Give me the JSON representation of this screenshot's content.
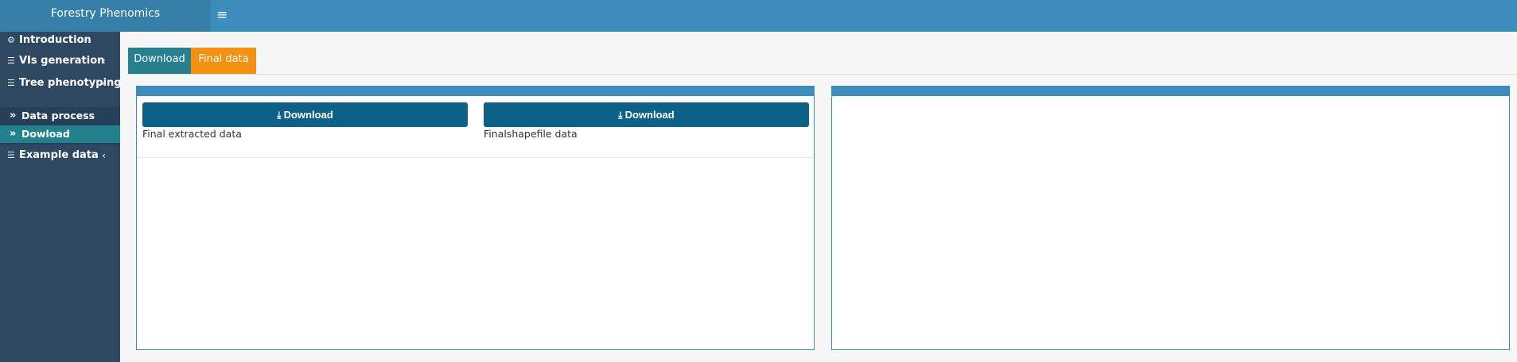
{
  "header": {
    "app_title": "Forestry Phenomics",
    "menu_toggle_glyph": "≡"
  },
  "sidebar": {
    "items": [
      {
        "label": "Introduction",
        "icon": "palette-icon",
        "glyph": "⚙"
      },
      {
        "label": "VIs generation",
        "icon": "database-icon",
        "glyph": "☰",
        "chevron": "‹"
      },
      {
        "label": "Tree phenotyping",
        "icon": "database-icon",
        "glyph": "☰",
        "chevron": "‹"
      },
      {
        "label": "Example data",
        "icon": "database-icon",
        "glyph": "☰",
        "chevron": "‹"
      }
    ],
    "subitems": [
      {
        "label": "Data process",
        "glyph": "»"
      },
      {
        "label": "Dowload",
        "glyph": "»",
        "active": true
      }
    ]
  },
  "tabs": [
    {
      "label": "Download",
      "active": true
    },
    {
      "label": "Final data"
    }
  ],
  "panel": {
    "buttons": [
      {
        "label": "Download",
        "icon": "download-icon",
        "glyph": "⤓",
        "caption": "Final extracted data"
      },
      {
        "label": "Download",
        "icon": "download-icon",
        "glyph": "⤓",
        "caption": "Finalshapefile data"
      }
    ]
  },
  "colors": {
    "header": "#3c8dbc",
    "sidebar": "#2f4862",
    "active_sub": "#23808d",
    "tab_active": "#26808d",
    "tab_orange": "#f39210",
    "button": "#0e6186"
  }
}
